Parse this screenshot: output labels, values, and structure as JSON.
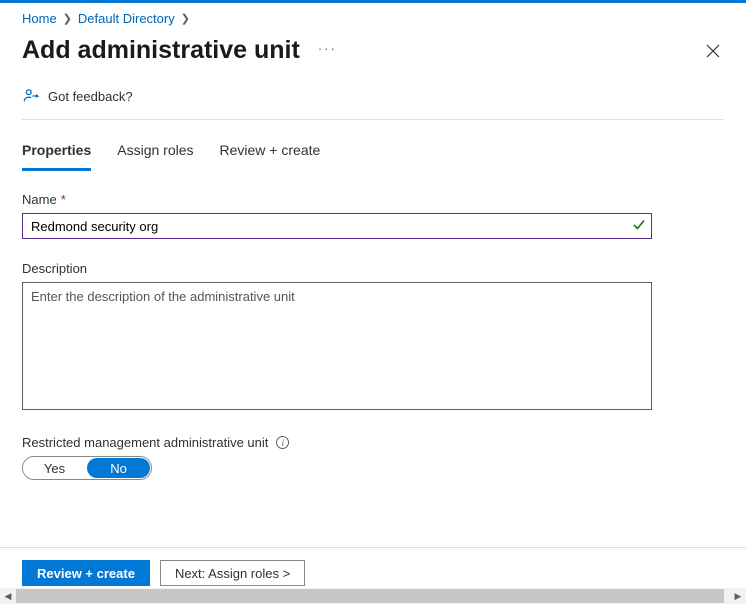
{
  "breadcrumb": {
    "home": "Home",
    "dir": "Default Directory"
  },
  "header": {
    "title": "Add administrative unit",
    "more": "···"
  },
  "feedback": {
    "label": "Got feedback?"
  },
  "tabs": {
    "properties": "Properties",
    "assign_roles": "Assign roles",
    "review_create": "Review + create"
  },
  "form": {
    "name_label": "Name",
    "name_value": "Redmond security org",
    "description_label": "Description",
    "description_placeholder": "Enter the description of the administrative unit",
    "restricted_label": "Restricted management administrative unit",
    "toggle_yes": "Yes",
    "toggle_no": "No",
    "toggle_value": "No"
  },
  "footer": {
    "primary": "Review + create",
    "secondary": "Next: Assign roles >"
  }
}
